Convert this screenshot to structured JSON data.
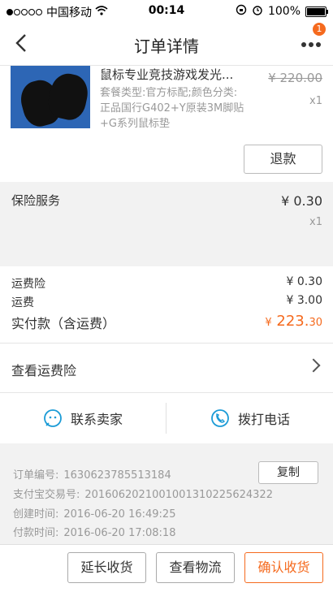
{
  "status_bar": {
    "carrier": "中国移动",
    "time": "00:14",
    "battery": "100%"
  },
  "nav": {
    "title": "订单详情",
    "badge": "1"
  },
  "goods": {
    "title": "鼠标专业竞技游戏发光...",
    "spec": "套餐类型:官方标配;颜色分类:正品国行G402+Y原装3M脚贴+G系列鼠标垫",
    "original_price": "¥ 220.00",
    "qty": "x1",
    "refund_label": "退款"
  },
  "insurance": {
    "label": "保险服务",
    "price": "¥ 0.30",
    "qty": "x1"
  },
  "fees": {
    "shipping_insurance_label": "运费险",
    "shipping_insurance_value": "¥ 0.30",
    "shipping_label": "运费",
    "shipping_value": "¥ 3.00",
    "total_label": "实付款（含运费）",
    "total_currency": "¥",
    "total_int": "223.",
    "total_dec": "30"
  },
  "view_insurance": {
    "label": "查看运费险"
  },
  "contact": {
    "seller_label": "联系卖家",
    "call_label": "拨打电话"
  },
  "order_info": {
    "order_no_label": "订单编号:",
    "order_no": "1630623785513184",
    "copy_label": "复制",
    "alipay_label": "支付宝交易号:",
    "alipay_no": "2016062021001001310225624322",
    "created_label": "创建时间:",
    "created": "2016-06-20 16:49:25",
    "paid_label": "付款时间:",
    "paid": "2016-06-20 17:08:18"
  },
  "bottom": {
    "extend_label": "延长收货",
    "logistics_label": "查看物流",
    "confirm_label": "确认收货"
  },
  "colors": {
    "accent": "#f56a1e",
    "icon_blue": "#1b9bd6"
  }
}
